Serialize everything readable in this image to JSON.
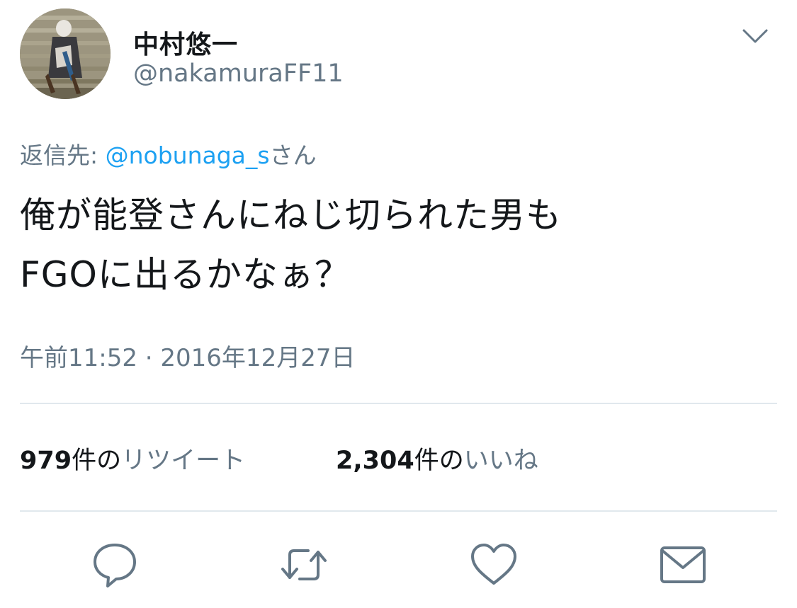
{
  "user": {
    "display_name": "中村悠一",
    "handle": "@nakamuraFF11",
    "avatar_icon": "profile-photo"
  },
  "reply": {
    "prefix": "返信先: ",
    "mention": "@nobunaga_s",
    "suffix": "さん"
  },
  "tweet": {
    "lines": [
      "俺が能登さんにねじ切られた男も",
      "FGOに出るかなぁ？"
    ]
  },
  "timestamp": "午前11:52 · 2016年12月27日",
  "stats": {
    "retweets": {
      "count": "979",
      "suffix": "件の",
      "label": "リツイート"
    },
    "likes": {
      "count": "2,304",
      "suffix": "件の",
      "label": "いいね"
    }
  },
  "actions": [
    "reply-icon",
    "retweet-icon",
    "like-icon",
    "share-mail-icon"
  ],
  "colors": {
    "link": "#1da1f2",
    "secondary_text": "#657786",
    "primary_text": "#14171a",
    "divider": "#e1e8ed",
    "icon": "#657786"
  }
}
